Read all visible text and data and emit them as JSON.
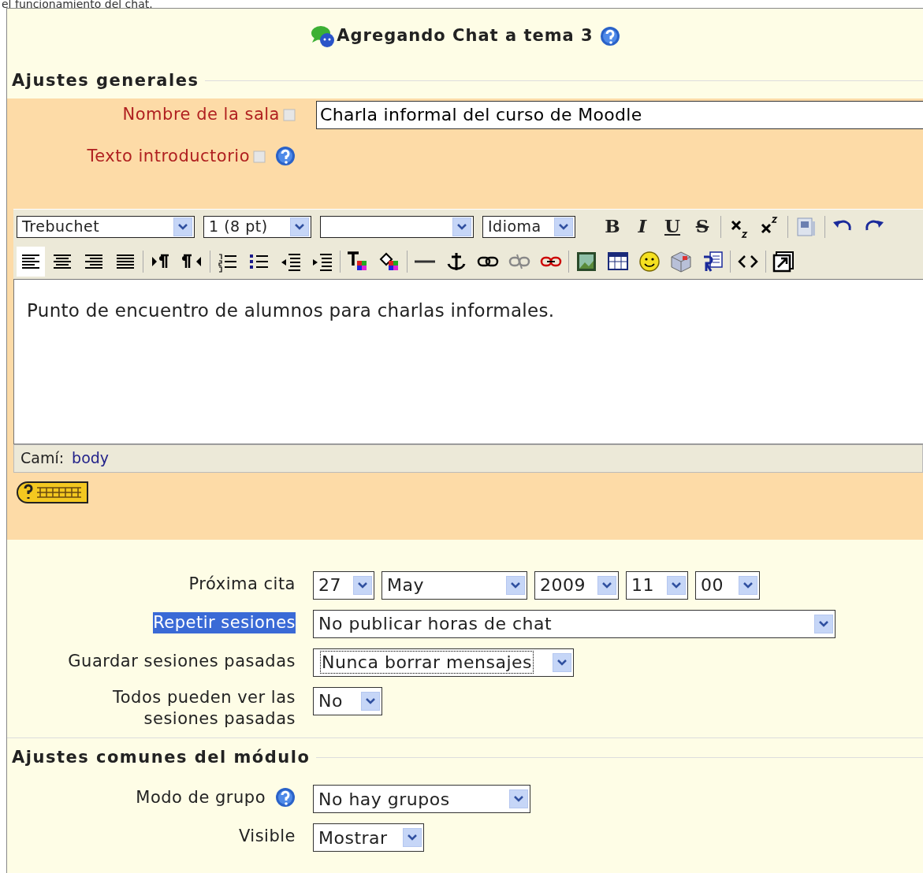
{
  "intro_text": "el funcionamiento del chat.",
  "title": "Agregando Chat a tema 3",
  "sections": [
    {
      "legend": "Ajustes generales",
      "fields": [
        {
          "kind": "text",
          "label": "Nombre de la sala",
          "required": true,
          "help": false,
          "value": "Charla informal del curso de Moodle"
        },
        {
          "kind": "editor",
          "label": "Texto introductorio",
          "required": true,
          "help": true,
          "selects": [
            {
              "kind": "filled",
              "value": "Trebuchet"
            },
            {
              "kind": "filled",
              "value": "1 (8 pt)"
            },
            {
              "kind": "blank"
            },
            {
              "kind": "filled",
              "value": "Idioma"
            }
          ],
          "format_buttons": [
            {
              "glyph": "B"
            },
            {
              "glyph": "I"
            },
            {
              "glyph": "U"
            },
            {
              "glyph": "S"
            }
          ],
          "align_buttons": [
            {
              "selected": true
            },
            {
              "selected": false
            },
            {
              "selected": false
            },
            {
              "selected": false
            }
          ],
          "content": "Punto de encuentro de alumnos para charlas informales.",
          "path_label": "Camí:",
          "path_link": "body"
        },
        {
          "kind": "dates",
          "label": "Próxima cita",
          "highlighted": false,
          "values": [
            "27",
            "May",
            "2009",
            "11",
            "00"
          ]
        },
        {
          "kind": "select",
          "label": "Repetir sesiones",
          "highlighted": true,
          "focused": false,
          "help": false,
          "value": "No publicar horas de chat"
        },
        {
          "kind": "select",
          "label": "Guardar sesiones pasadas",
          "highlighted": false,
          "focused": true,
          "help": false,
          "value": "Nunca borrar mensajes"
        },
        {
          "kind": "select",
          "label": "Todos pueden ver las sesiones pasadas",
          "highlighted": false,
          "focused": false,
          "help": false,
          "value": "No"
        }
      ]
    },
    {
      "legend": "Ajustes comunes del módulo",
      "fields": [
        {
          "kind": "select",
          "label": "Modo de grupo",
          "highlighted": false,
          "focused": false,
          "help": true,
          "value": "No hay grupos"
        },
        {
          "kind": "select",
          "label": "Visible",
          "highlighted": false,
          "focused": false,
          "help": false,
          "value": "Mostrar"
        }
      ]
    }
  ]
}
